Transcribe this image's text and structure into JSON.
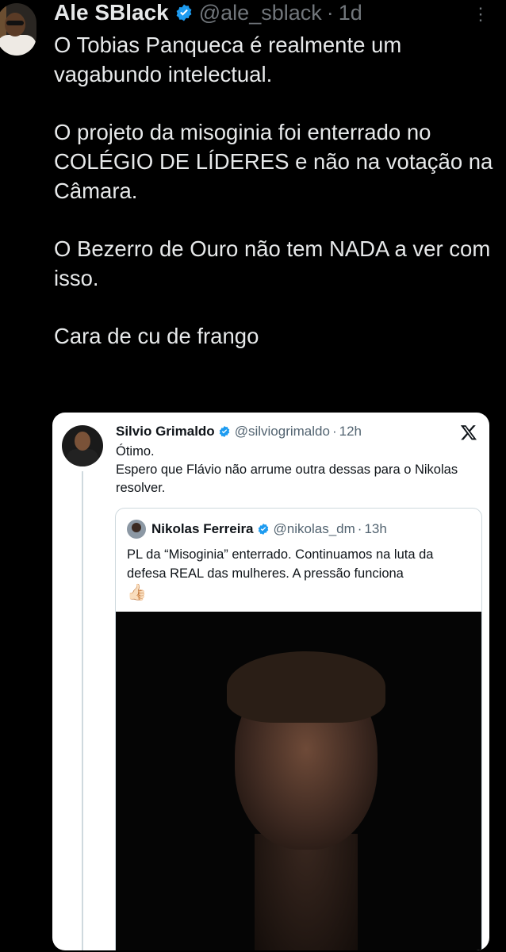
{
  "tweet": {
    "author_name": "Ale SBlack",
    "handle": "@ale_sblack",
    "separator": "·",
    "time": "1d",
    "more_icon": "more-vertical-icon",
    "paragraphs": [
      "O Tobias Panqueca é realmente um vagabundo intelectual.",
      "O projeto da misoginia foi enterrado no COLÉGIO DE LÍDERES e não na votação na Câmara.",
      "O Bezerro de Ouro não tem NADA a ver com isso.",
      "Cara de cu de frango"
    ]
  },
  "embedded": {
    "author_name": "Silvio Grimaldo",
    "handle": "@silviogrimaldo",
    "separator": "·",
    "time": "12h",
    "logo": "x-logo-icon",
    "line1": "Ótimo.",
    "line2": "Espero que Flávio não arrume outra dessas para o Nikolas resolver.",
    "quote": {
      "author_name": "Nikolas Ferreira",
      "handle": "@nikolas_dm",
      "separator": "·",
      "time": "13h",
      "text": "PL da “Misoginia” enterrado. Continuamos na luta da defesa REAL das mulheres. A pressão funciona",
      "emoji": "👍🏻"
    }
  },
  "colors": {
    "background": "#000000",
    "text": "#e7e9ea",
    "muted": "#71767b",
    "verified_blue": "#1d9bf0"
  }
}
